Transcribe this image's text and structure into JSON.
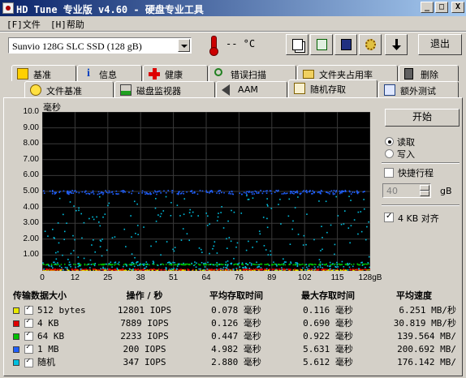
{
  "window": {
    "title": "HD Tune 专业版 v4.60 - 硬盘专业工具",
    "min": "_",
    "max": "□",
    "close": "X"
  },
  "menu": {
    "file": "[F]文件",
    "help": "[H]帮助"
  },
  "toolbar": {
    "drive": "Sunvio 128G SLC SSD (128 gB)",
    "temperature": "-- °C",
    "exit": "退出"
  },
  "tabs_row1": [
    "基准",
    "信息",
    "健康",
    "错误扫描",
    "文件夹占用率",
    "删除"
  ],
  "tabs_row2": [
    "文件基准",
    "磁盘监视器",
    "AAM",
    "随机存取",
    "额外测试"
  ],
  "active_tab": "随机存取",
  "controls": {
    "start": "开始",
    "read": "读取",
    "write": "写入",
    "short_stroke": "快捷行程",
    "stroke_value": "40",
    "stroke_unit": "gB",
    "align": "4 KB 对齐"
  },
  "chart_data": {
    "type": "scatter",
    "ylabel": "毫秒",
    "xlabel": "gB",
    "ylim": [
      0,
      10
    ],
    "xlim": [
      0,
      128
    ],
    "yticks": [
      "10.0",
      "9.00",
      "8.00",
      "7.00",
      "6.00",
      "5.00",
      "4.00",
      "3.00",
      "2.00",
      "1.00"
    ],
    "xticks": [
      "0",
      "12",
      "25",
      "38",
      "51",
      "64",
      "76",
      "89",
      "102",
      "115",
      "128gB"
    ],
    "grid": true,
    "series": [
      {
        "name": "512 bytes",
        "color": "#e8e800",
        "level": 0.078
      },
      {
        "name": "4 KB",
        "color": "#e00000",
        "level": 0.126
      },
      {
        "name": "64 KB",
        "color": "#00c000",
        "level": 0.447
      },
      {
        "name": "1 MB",
        "color": "#2060ff",
        "level": 4.982
      },
      {
        "name": "随机",
        "color": "#00c0e0",
        "level": 2.88
      }
    ]
  },
  "results": {
    "headers": [
      "传输数据大小",
      "操作 / 秒",
      "平均存取时间",
      "最大存取时间",
      "平均速度"
    ],
    "rows": [
      {
        "size": "512 bytes",
        "color": "#e8e800",
        "ops": "12801",
        "ops_unit": "IOPS",
        "avg": "0.078",
        "avg_unit": "毫秒",
        "max": "0.116",
        "max_unit": "毫秒",
        "speed": "6.251",
        "speed_unit": "MB/秒"
      },
      {
        "size": "4 KB",
        "color": "#e00000",
        "ops": "7889",
        "ops_unit": "IOPS",
        "avg": "0.126",
        "avg_unit": "毫秒",
        "max": "0.690",
        "max_unit": "毫秒",
        "speed": "30.819",
        "speed_unit": "MB/秒"
      },
      {
        "size": "64 KB",
        "color": "#00c000",
        "ops": "2233",
        "ops_unit": "IOPS",
        "avg": "0.447",
        "avg_unit": "毫秒",
        "max": "0.922",
        "max_unit": "毫秒",
        "speed": "139.564",
        "speed_unit": "MB/"
      },
      {
        "size": "1 MB",
        "color": "#2060ff",
        "ops": "200",
        "ops_unit": "IOPS",
        "avg": "4.982",
        "avg_unit": "毫秒",
        "max": "5.631",
        "max_unit": "毫秒",
        "speed": "200.692",
        "speed_unit": "MB/"
      },
      {
        "size": "随机",
        "color": "#00c0e0",
        "ops": "347",
        "ops_unit": "IOPS",
        "avg": "2.880",
        "avg_unit": "毫秒",
        "max": "5.612",
        "max_unit": "毫秒",
        "speed": "176.142",
        "speed_unit": "MB/"
      }
    ]
  }
}
